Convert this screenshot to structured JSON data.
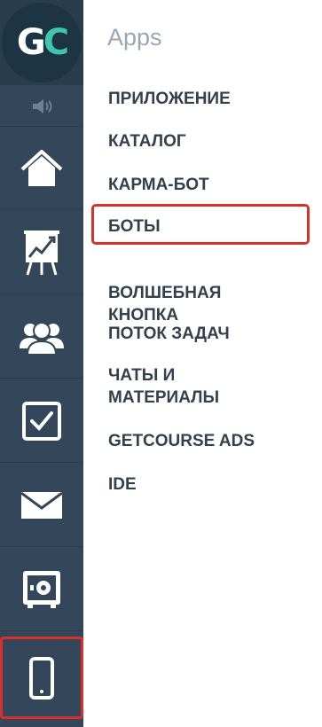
{
  "logo": {
    "letter_g": "G",
    "letter_c": "C"
  },
  "colors": {
    "rail": "#34475a",
    "logo_accent": "#3fc4b0",
    "highlight": "#d9302b",
    "menu_text": "#33404d",
    "menu_title": "#9aa6b2"
  },
  "rail": {
    "items": [
      {
        "icon": "home-icon"
      },
      {
        "icon": "chart-board-icon"
      },
      {
        "icon": "users-icon"
      },
      {
        "icon": "checkbox-icon"
      },
      {
        "icon": "mail-icon"
      },
      {
        "icon": "safe-icon"
      },
      {
        "icon": "mobile-phone-icon",
        "active": true
      }
    ]
  },
  "menu": {
    "title": "Apps",
    "items": [
      "ПРИЛОЖЕНИЕ",
      "КАТАЛОГ",
      "КАРМА-БОТ",
      "БОТЫ",
      "ВОЛШЕБНАЯ КНОПКА",
      "ПОТОК ЗАДАЧ",
      "ЧАТЫ И МАТЕРИАЛЫ",
      "GETCOURSE ADS",
      "IDE"
    ],
    "highlighted": "БОТЫ"
  }
}
